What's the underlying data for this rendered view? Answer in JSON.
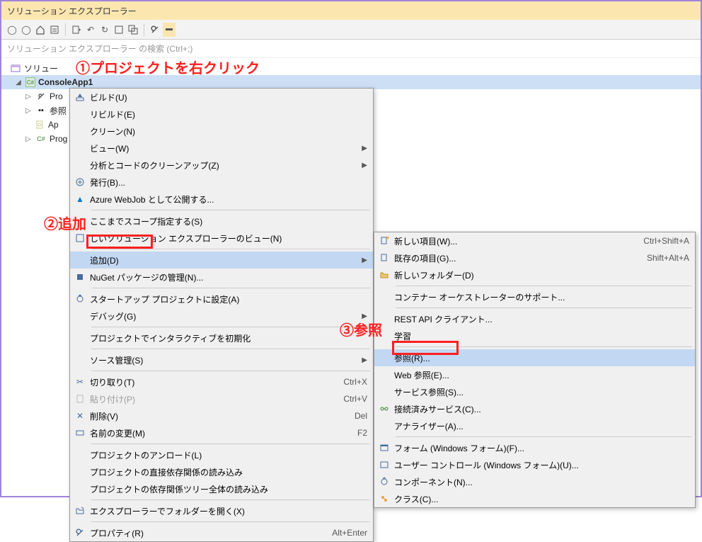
{
  "title": "ソリューション エクスプローラー",
  "search_placeholder": "ソリューション エクスプローラー の検索 (Ctrl+;)",
  "tree": {
    "solution": "ソリュー",
    "project": "ConsoleApp1",
    "nodes": {
      "properties": "Pro",
      "references": "参照",
      "appconfig": "Ap",
      "program": "Prog"
    }
  },
  "annotations": {
    "a1": "①プロジェクトを右クリック",
    "a2": "②追加",
    "a3": "③参照"
  },
  "menu": {
    "build": "ビルド(U)",
    "rebuild": "リビルド(E)",
    "clean": "クリーン(N)",
    "view": "ビュー(W)",
    "analyze": "分析とコードのクリーンアップ(Z)",
    "publish": "発行(B)...",
    "azure": "Azure WebJob として公開する...",
    "scope": "ここまでスコープ指定する(S)",
    "newview": "しいソリューション エクスプローラーのビュー(N)",
    "add": "追加(D)",
    "nuget": "NuGet パッケージの管理(N)...",
    "startup": "スタートアップ プロジェクトに設定(A)",
    "debug": "デバッグ(G)",
    "interactive": "プロジェクトでインタラクティブを初期化",
    "source": "ソース管理(S)",
    "cut": "切り取り(T)",
    "paste": "貼り付け(P)",
    "delete": "削除(V)",
    "rename": "名前の変更(M)",
    "unload": "プロジェクトのアンロード(L)",
    "deps": "プロジェクトの直接依存関係の読み込み",
    "depstree": "プロジェクトの依存関係ツリー全体の読み込み",
    "openfolder": "エクスプローラーでフォルダーを開く(X)",
    "properties": "プロパティ(R)",
    "sc_cut": "Ctrl+X",
    "sc_paste": "Ctrl+V",
    "sc_del": "Del",
    "sc_rename": "F2",
    "sc_props": "Alt+Enter"
  },
  "submenu": {
    "newitem": "新しい項目(W)...",
    "existingitem": "既存の項目(G)...",
    "newfolder": "新しいフォルダー(D)",
    "container": "コンテナー オーケストレーターのサポート...",
    "restapi": "REST API クライアント...",
    "ml": "学習",
    "reference": "参照(R)...",
    "webref": "Web 参照(E)...",
    "serviceref": "サービス参照(S)...",
    "connected": "接続済みサービス(C)...",
    "analyzer": "アナライザー(A)...",
    "form": "フォーム (Windows フォーム)(F)...",
    "usercontrol": "ユーザー コントロール (Windows フォーム)(U)...",
    "component": "コンポーネント(N)...",
    "class": "クラス(C)...",
    "sc_newitem": "Ctrl+Shift+A",
    "sc_existingitem": "Shift+Alt+A"
  }
}
